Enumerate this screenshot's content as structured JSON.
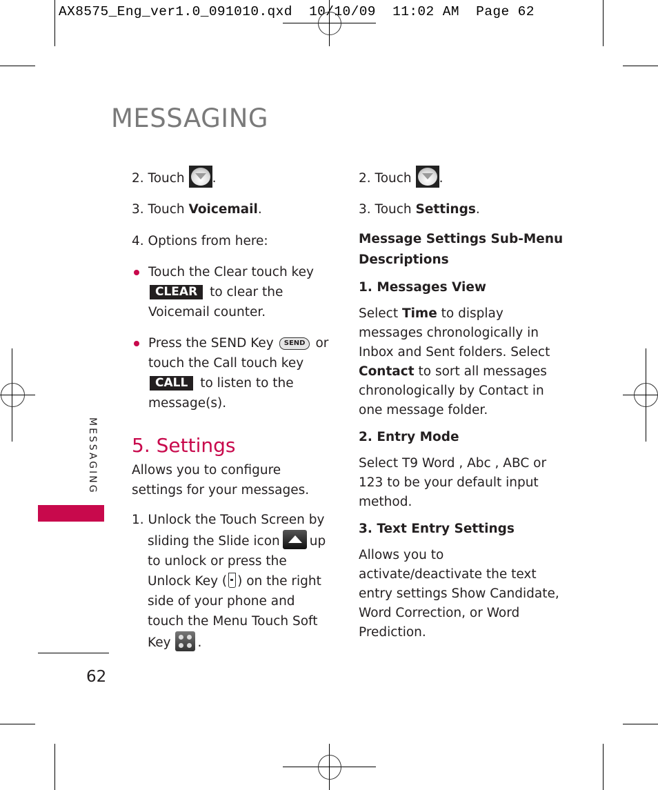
{
  "slug": {
    "filename": "AX8575_Eng_ver1.0_091010.qxd",
    "date": "10/10/09",
    "time": "11:02 AM",
    "page_label": "Page 62"
  },
  "page_title": "MESSAGING",
  "left_column": {
    "step2": {
      "prefix": "2. Touch",
      "suffix": "."
    },
    "step3": {
      "prefix": "3. Touch ",
      "bold": "Voicemail",
      "suffix": "."
    },
    "step4": "4. Options from here:",
    "bullets": [
      {
        "text_before": "Touch the Clear touch key",
        "key_label": "CLEAR",
        "text_after": "to clear the Voicemail counter."
      },
      {
        "text_before": "Press the SEND Key",
        "send_key_label": "SEND",
        "text_mid": "or touch the Call touch key",
        "key_label": "CALL",
        "text_after": "to listen to the message(s)."
      }
    ],
    "section_title": "5. Settings",
    "section_intro": "Allows you to configure settings for your messages.",
    "step1": {
      "part1": "1. Unlock the Touch Screen by sliding the Slide icon",
      "part2": "up to unlock or press the Unlock Key (",
      "part3": ") on the right side of your phone and touch the Menu Touch Soft Key",
      "part4": "."
    }
  },
  "right_column": {
    "step2": {
      "prefix": "2. Touch",
      "suffix": "."
    },
    "step3": {
      "prefix": "3. Touch ",
      "bold": "Settings",
      "suffix": "."
    },
    "subheading": "Message Settings Sub-Menu Descriptions",
    "items": [
      {
        "title": "1. Messages View",
        "body_parts": [
          "Select ",
          "Time",
          " to display messages chronologically in Inbox and Sent folders. Select ",
          "Contact",
          " to sort all messages chronologically by Contact in one message folder."
        ]
      },
      {
        "title": "2. Entry Mode",
        "body": "Select T9 Word , Abc , ABC or 123 to be your default input method."
      },
      {
        "title": "3. Text Entry Settings",
        "body": "Allows you to activate/deactivate the text entry settings Show Candidate, Word Correction, or Word Prediction."
      }
    ]
  },
  "side_tab": {
    "label": "MESSAGING",
    "color": "#c8094c"
  },
  "page_number": "62",
  "icons": {
    "messaging": "envelope-icon",
    "slide": "slide-up-icon",
    "unlock": "unlock-key-icon",
    "menu": "menu-grid-icon",
    "send": "send-key-icon"
  },
  "colors": {
    "accent": "#c8094c",
    "title_gray": "#7a7a7a",
    "text": "#231f20"
  }
}
